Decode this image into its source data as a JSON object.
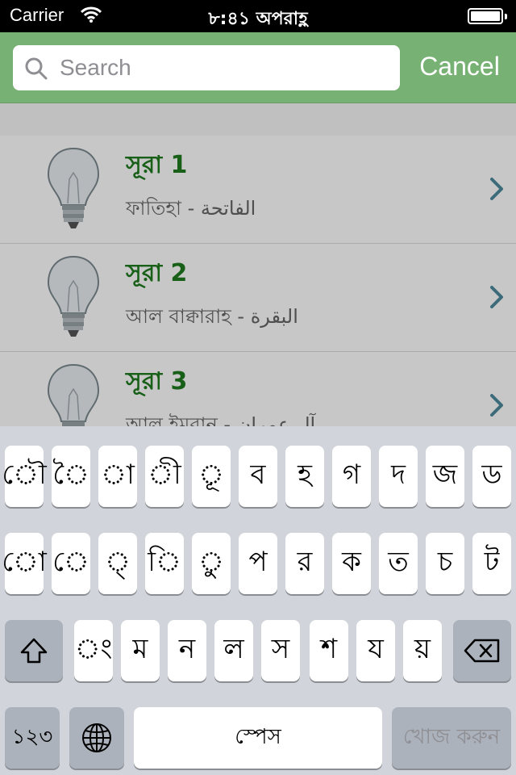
{
  "status": {
    "carrier": "Carrier",
    "time": "৮:৪১ অপরাহ্ণ"
  },
  "search": {
    "placeholder": "Search",
    "value": "",
    "cancel_label": "Cancel"
  },
  "suras": [
    {
      "title": "সূরা 1",
      "subtitle": "ফাতিহা - الفاتحة"
    },
    {
      "title": "সূরা 2",
      "subtitle": "আল বাক্বারাহ - البقرة"
    },
    {
      "title": "সূরা 3",
      "subtitle": "আল ইমরান - آل عمران"
    }
  ],
  "keyboard": {
    "row1": [
      "ৌ",
      "ৈ",
      "া",
      "ী",
      "ূ",
      "ব",
      "হ",
      "গ",
      "দ",
      "জ",
      "ড"
    ],
    "row2": [
      "ো",
      "ে",
      "্",
      "ি",
      "ু",
      "প",
      "র",
      "ক",
      "ত",
      "চ",
      "ট"
    ],
    "row3": [
      "ং",
      "ম",
      "ন",
      "ল",
      "স",
      "শ",
      "য",
      "য়"
    ],
    "numbers_label": "১২৩",
    "space_label": "স্পেস",
    "search_label": "খোজ করুন"
  },
  "colors": {
    "accent": "#78b174",
    "title_green": "#1f7a1f"
  }
}
